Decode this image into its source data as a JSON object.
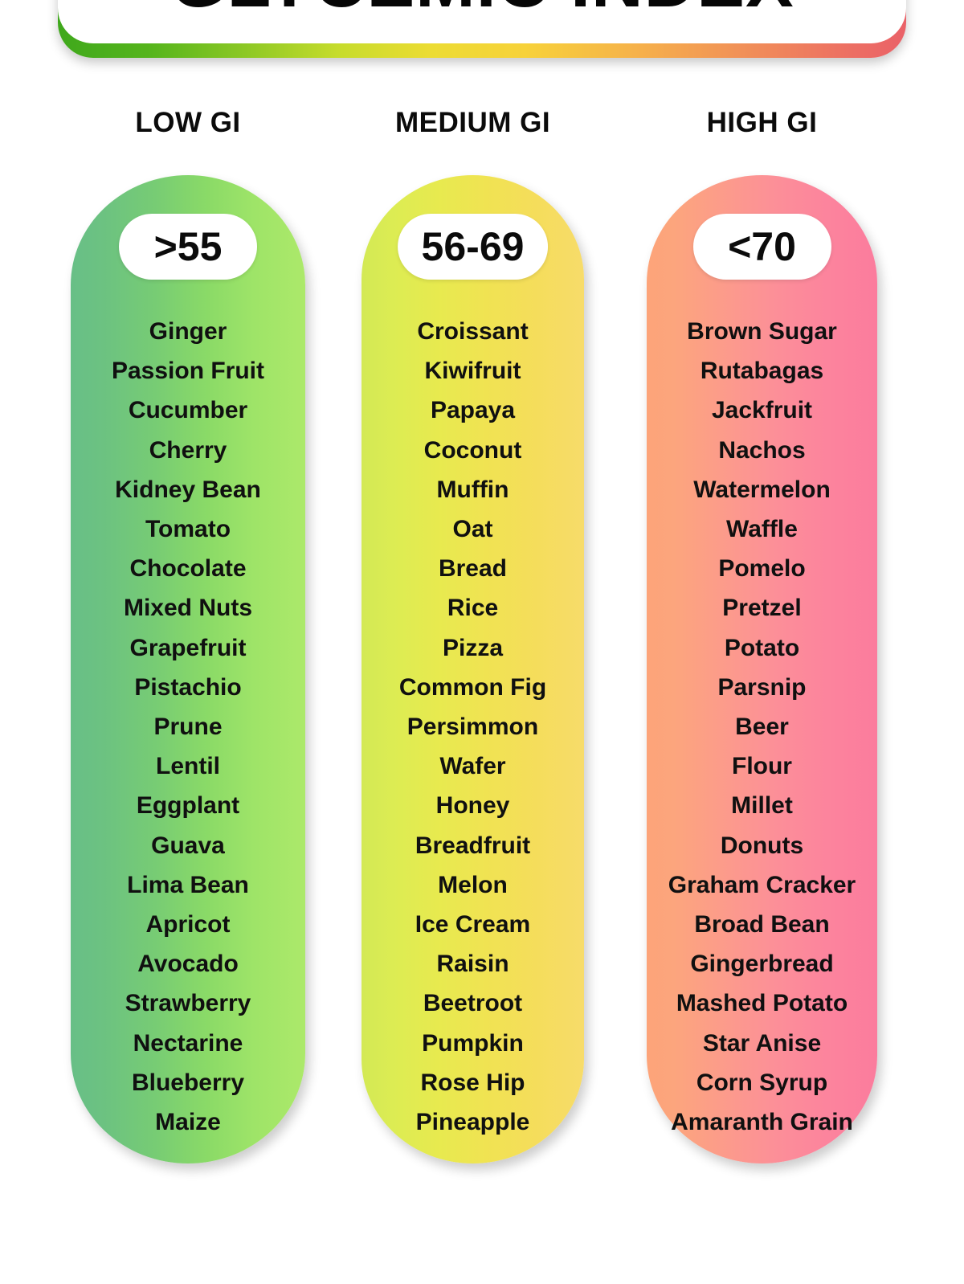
{
  "header": {
    "title": "GLYCEMIC INDEX",
    "gradient_start": "#3fa81c",
    "gradient_mid": "#f7d23a",
    "gradient_end": "#ea6168"
  },
  "columns": [
    {
      "heading": "LOW GI",
      "badge": ">55",
      "accent_start": "#68bf87",
      "accent_end": "#ace96a",
      "foods": [
        "Ginger",
        "Passion Fruit",
        "Cucumber",
        "Cherry",
        "Kidney Bean",
        "Tomato",
        "Chocolate",
        "Mixed Nuts",
        "Grapefruit",
        "Pistachio",
        "Prune",
        "Lentil",
        "Eggplant",
        "Guava",
        "Lima Bean",
        "Apricot",
        "Avocado",
        "Strawberry",
        "Nectarine",
        "Blueberry",
        "Maize"
      ]
    },
    {
      "heading": "MEDIUM GI",
      "badge": "56-69",
      "accent_start": "#d3e955",
      "accent_end": "#f7dc6a",
      "foods": [
        "Croissant",
        "Kiwifruit",
        "Papaya",
        "Coconut",
        "Muffin",
        "Oat",
        "Bread",
        "Rice",
        "Pizza",
        "Common Fig",
        "Persimmon",
        "Wafer",
        "Honey",
        "Breadfruit",
        "Melon",
        "Ice Cream",
        "Raisin",
        "Beetroot",
        "Pumpkin",
        "Rose Hip",
        "Pineapple"
      ]
    },
    {
      "heading": "HIGH GI",
      "badge": "<70",
      "accent_start": "#fda479",
      "accent_end": "#fb7c9d",
      "foods": [
        "Brown Sugar",
        "Rutabagas",
        "Jackfruit",
        "Nachos",
        "Watermelon",
        "Waffle",
        "Pomelo",
        "Pretzel",
        "Potato",
        "Parsnip",
        "Beer",
        "Flour",
        "Millet",
        "Donuts",
        "Graham Cracker",
        "Broad Bean",
        "Gingerbread",
        "Mashed Potato",
        "Star Anise",
        "Corn Syrup",
        "Amaranth Grain"
      ]
    }
  ]
}
